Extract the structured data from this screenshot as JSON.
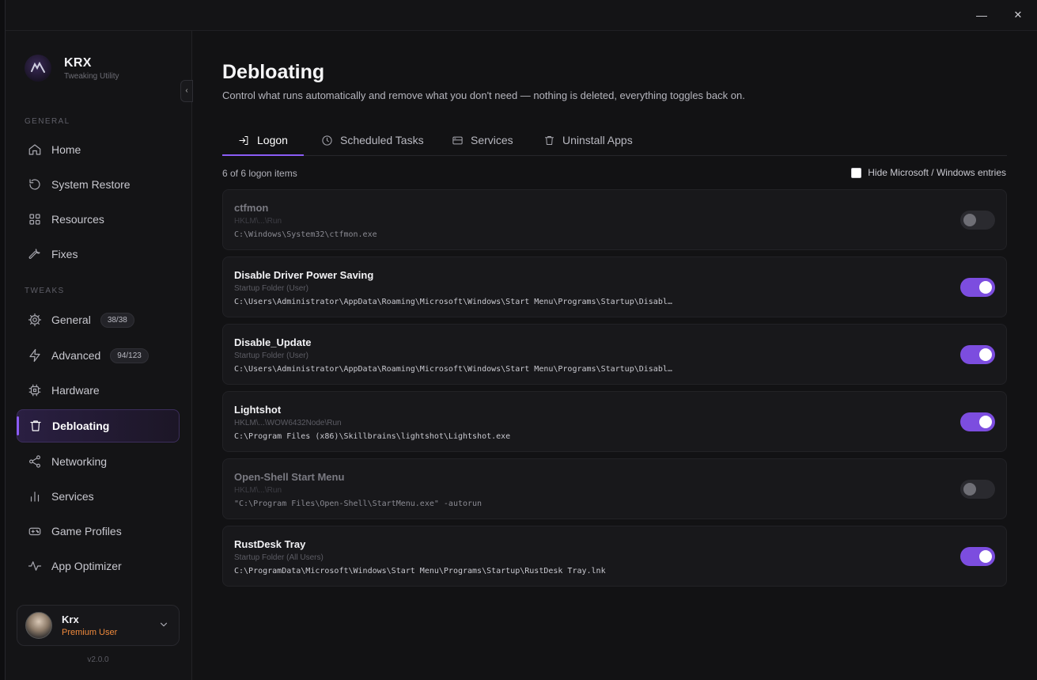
{
  "window": {
    "minimize_label": "—",
    "close_label": "✕"
  },
  "brand": {
    "name": "KRX",
    "subtitle": "Tweaking Utility"
  },
  "sidebar": {
    "collapse_label": "‹",
    "general_label": "GENERAL",
    "tweaks_label": "TWEAKS",
    "general_items": [
      {
        "label": "Home",
        "icon": "home-icon"
      },
      {
        "label": "System Restore",
        "icon": "restore-icon"
      },
      {
        "label": "Resources",
        "icon": "grid-icon"
      },
      {
        "label": "Fixes",
        "icon": "wrench-icon"
      }
    ],
    "tweak_items": [
      {
        "label": "General",
        "icon": "gear-icon",
        "badge": "38/38"
      },
      {
        "label": "Advanced",
        "icon": "bolt-icon",
        "badge": "94/123"
      },
      {
        "label": "Hardware",
        "icon": "chip-icon"
      },
      {
        "label": "Debloating",
        "icon": "trash-icon",
        "active": true
      },
      {
        "label": "Networking",
        "icon": "share-icon"
      },
      {
        "label": "Services",
        "icon": "bars-icon"
      },
      {
        "label": "Game Profiles",
        "icon": "gamepad-icon"
      },
      {
        "label": "App Optimizer",
        "icon": "pulse-icon"
      }
    ]
  },
  "user": {
    "name": "Krx",
    "role": "Premium User"
  },
  "version": "v2.0.0",
  "colors": {
    "accent": "#8b5cf6",
    "toggle_on": "#7c4ddf",
    "premium": "#f08a3c"
  },
  "page": {
    "title": "Debloating",
    "description": "Control what runs automatically and remove what you don't need — nothing is deleted, everything toggles back on."
  },
  "tabs": [
    {
      "label": "Logon",
      "icon": "login-icon",
      "active": true
    },
    {
      "label": "Scheduled Tasks",
      "icon": "clock-icon"
    },
    {
      "label": "Services",
      "icon": "server-icon"
    },
    {
      "label": "Uninstall Apps",
      "icon": "trash-icon"
    }
  ],
  "list": {
    "count_text": "6 of 6 logon items",
    "filter_label": "Hide Microsoft / Windows entries",
    "filter_checked": false,
    "items": [
      {
        "name": "ctfmon",
        "source": "HKLM\\...\\Run",
        "path": "C:\\Windows\\System32\\ctfmon.exe",
        "enabled": false
      },
      {
        "name": "Disable Driver Power Saving",
        "source": "Startup Folder (User)",
        "path": "C:\\Users\\Administrator\\AppData\\Roaming\\Microsoft\\Windows\\Start Menu\\Programs\\Startup\\Disabl…",
        "enabled": true
      },
      {
        "name": "Disable_Update",
        "source": "Startup Folder (User)",
        "path": "C:\\Users\\Administrator\\AppData\\Roaming\\Microsoft\\Windows\\Start Menu\\Programs\\Startup\\Disabl…",
        "enabled": true
      },
      {
        "name": "Lightshot",
        "source": "HKLM\\...\\WOW6432Node\\Run",
        "path": "C:\\Program Files (x86)\\Skillbrains\\lightshot\\Lightshot.exe",
        "enabled": true
      },
      {
        "name": "Open-Shell Start Menu",
        "source": "HKLM\\...\\Run",
        "path": "\"C:\\Program Files\\Open-Shell\\StartMenu.exe\" -autorun",
        "enabled": false
      },
      {
        "name": "RustDesk Tray",
        "source": "Startup Folder (All Users)",
        "path": "C:\\ProgramData\\Microsoft\\Windows\\Start Menu\\Programs\\Startup\\RustDesk Tray.lnk",
        "enabled": true
      }
    ]
  }
}
